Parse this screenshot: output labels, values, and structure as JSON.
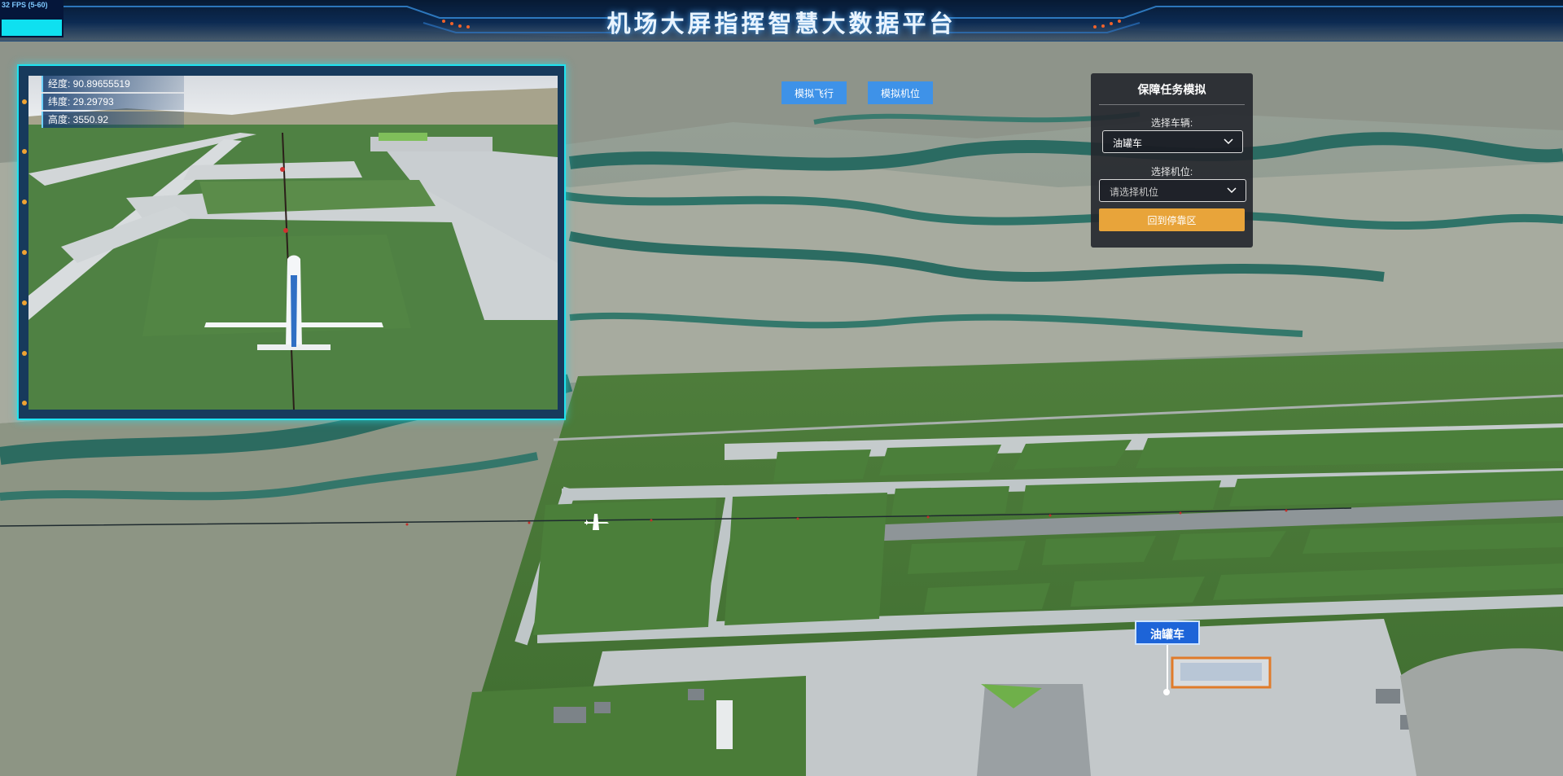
{
  "header": {
    "title": "机场大屏指挥智慧大数据平台"
  },
  "fps": {
    "label": "32 FPS (5-60)"
  },
  "toolbar": {
    "simulate_flight": "模拟飞行",
    "simulate_stand": "模拟机位"
  },
  "task_panel": {
    "title": "保障任务模拟",
    "vehicle_label": "选择车辆:",
    "vehicle_value": "油罐车",
    "stand_label": "选择机位:",
    "stand_placeholder": "请选择机位",
    "return_button": "回到停靠区"
  },
  "inset": {
    "longitude": "经度: 90.89655519",
    "latitude": "纬度: 29.29793",
    "altitude": "高度: 3550.92"
  },
  "map": {
    "vehicle_tag": "油罐车"
  },
  "colors": {
    "header_bg": "#0c2a52",
    "button_blue": "#3e92e8",
    "button_orange": "#e8a43a",
    "inset_border": "#1fe3f0",
    "tag_blue": "#1d64d8"
  }
}
